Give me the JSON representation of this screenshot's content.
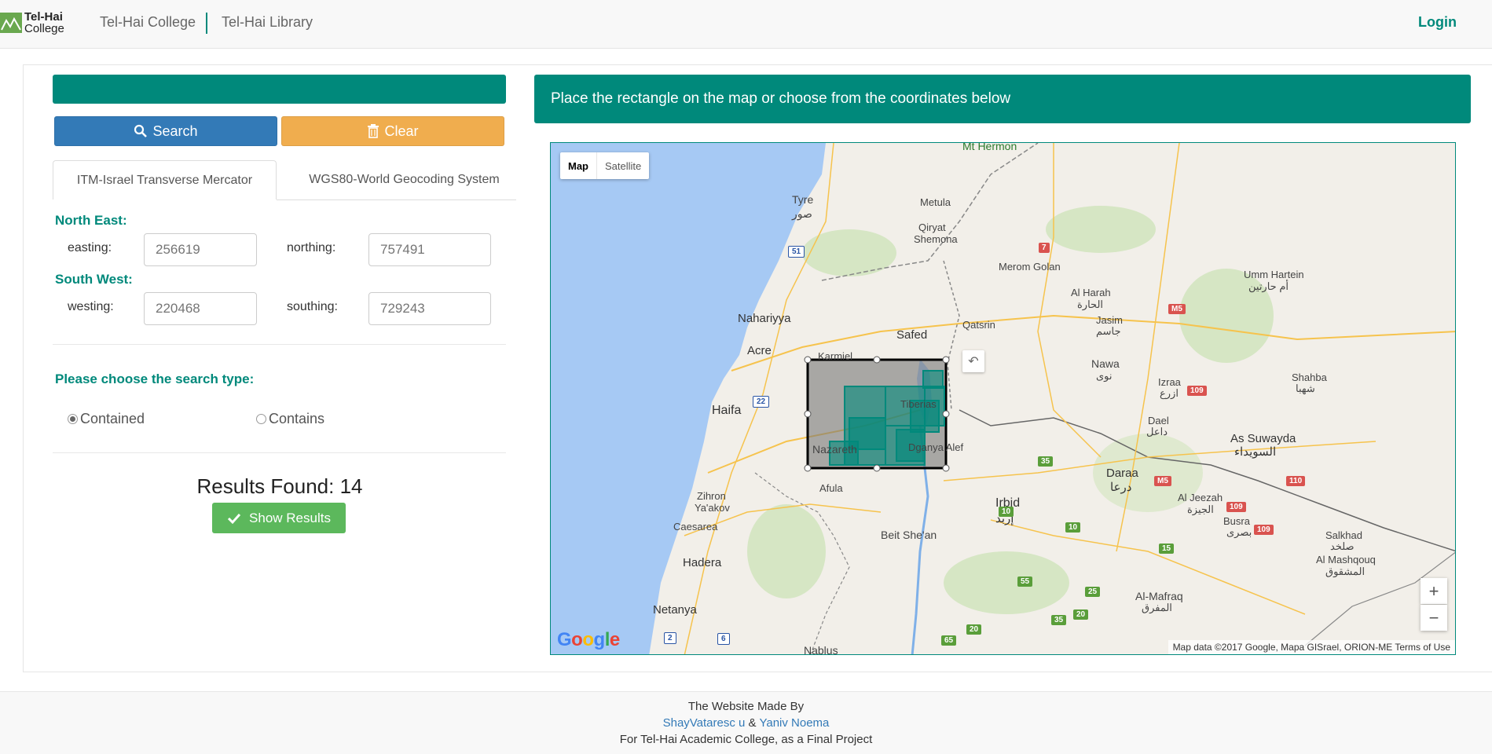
{
  "navbar": {
    "logo_line1": "Tel-Hai",
    "logo_line2": "College",
    "link_college": "Tel-Hai College",
    "link_library": "Tel-Hai Library",
    "login": "Login"
  },
  "left_panel": {
    "search_label": "Search",
    "clear_label": "Clear",
    "tabs": [
      {
        "label": "ITM-Israel Transverse Mercator",
        "active": true
      },
      {
        "label": "WGS80-World Geocoding System",
        "active": false
      }
    ],
    "north_east": {
      "label": "North East:",
      "easting_label": "easting:",
      "easting_placeholder": "256619",
      "northing_label": "northing:",
      "northing_placeholder": "757491"
    },
    "south_west": {
      "label": "South West:",
      "westing_label": "westing:",
      "westing_placeholder": "220468",
      "southing_label": "southing:",
      "southing_placeholder": "729243"
    },
    "search_type_label": "Please choose the search type:",
    "radio_contained": "Contained",
    "radio_contains": "Contains",
    "selected_search_type": "Contained",
    "results_found": "Results Found: 14",
    "show_results_label": "Show Results"
  },
  "map_panel": {
    "header": "Place the rectangle on the map or choose from the coordinates below",
    "map_type": {
      "map": "Map",
      "satellite": "Satellite",
      "selected": "Map"
    },
    "places": {
      "mt_hermon": "Mt Hermon",
      "tyre": "Tyre",
      "tyre_ar": "صور",
      "metula": "Metula",
      "qiryat": "Qiryat",
      "shemona": "Shemona",
      "merom_golan": "Merom Golan",
      "al_harah": "Al Harah",
      "al_harah_ar": "الحارة",
      "jasim": "Jasim",
      "jasim_ar": "جاسم",
      "umm_hartein": "Umm Hartein",
      "umm_hartein_ar": "أم حارتين",
      "nahariyya": "Nahariyya",
      "safed": "Safed",
      "qatsrin": "Qatsrin",
      "acre": "Acre",
      "karmiel": "Karmiel",
      "nawa": "Nawa",
      "nawa_ar": "نوى",
      "izraa": "Izraa",
      "izraa_ar": "ازرع",
      "shahba": "Shahba",
      "shahba_ar": "شهبا",
      "haifa": "Haifa",
      "tiberias": "Tiberias",
      "dael": "Dael",
      "dael_ar": "داعل",
      "as_suwayda": "As Suwayda",
      "as_suwayda_ar": "السويداء",
      "nazareth": "Nazareth",
      "dganya_alef": "Dganya Alef",
      "daraa": "Daraa",
      "daraa_ar": "درعا",
      "afula": "Afula",
      "irbid": "Irbid",
      "irbid_ar": "إربد",
      "al_jeezah": "Al Jeezah",
      "al_jeezah_ar": "الجيزة",
      "busra": "Busra",
      "busra_ar": "بصرى",
      "zihron": "Zihron",
      "yaakov": "Ya'akov",
      "caesarea": "Caesarea",
      "beit_shean": "Beit She'an",
      "salkhad": "Salkhad",
      "salkhad_ar": "صلخد",
      "al_mashquq": "Al Mashqouq",
      "al_mashquq_ar": "المشقوق",
      "hadera": "Hadera",
      "al_mafraq": "Al-Mafraq",
      "al_mafraq_ar": "المفرق",
      "netanya": "Netanya",
      "nablus": "Nablus"
    },
    "roads": {
      "r7": "7",
      "r51": "51",
      "m5a": "M5",
      "r109a": "109",
      "r22": "22",
      "r35": "35",
      "m5b": "M5",
      "r110": "110",
      "r10a": "10",
      "r10b": "10",
      "r109b": "109",
      "r109c": "109",
      "r15": "15",
      "r55": "55",
      "r25": "25",
      "r35b": "35",
      "r20a": "20",
      "r20b": "20",
      "r65": "65",
      "r2": "2",
      "r6": "6"
    },
    "google": "Google",
    "attribution": "Map data ©2017 Google, Mapa GISrael, ORION-ME     Terms of Use",
    "zoom_in": "+",
    "zoom_out": "−",
    "colors": {
      "water": "#a5c8f5",
      "land": "#f1efe8",
      "selection": "#00897b",
      "rect_fill": "#777777"
    }
  },
  "footer": {
    "line1": "The Website Made By",
    "author1": "Shay Vataresc u",
    "amp": "&",
    "author2": "Yaniv Noema",
    "line3": "For Tel-Hai Academic College, as a Final Project"
  },
  "colors": {
    "primary": "#00897b",
    "search_btn": "#337ab7",
    "clear_btn": "#f0ad4e",
    "show_btn": "#5cb85c"
  }
}
